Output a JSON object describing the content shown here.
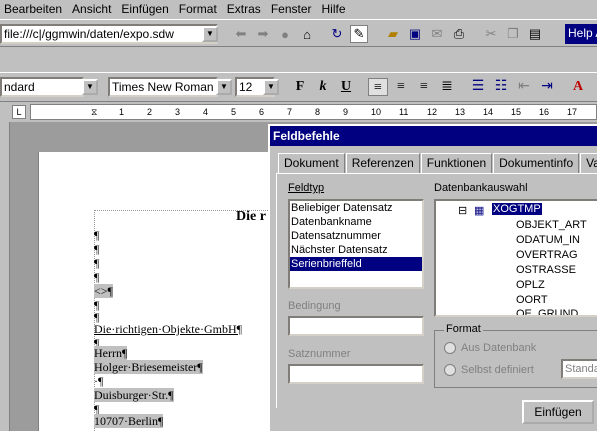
{
  "menu": [
    "Bearbeiten",
    "Ansicht",
    "Einfügen",
    "Format",
    "Extras",
    "Fenster",
    "Hilfe"
  ],
  "url": "file:///c|/ggmwin/daten/expo.sdw",
  "help_label": "Help A",
  "toolbar2": {
    "style": "ndard",
    "font": "Times New Roman",
    "size": "12"
  },
  "ruler": [
    "1",
    "2",
    "3",
    "4",
    "5",
    "6",
    "7",
    "8",
    "9",
    "10",
    "11",
    "12",
    "13",
    "14",
    "15",
    "16",
    "17"
  ],
  "document": {
    "title": "Die r",
    "lines": [
      "¶",
      "¶",
      "¶",
      "¶",
      "<>¶",
      "¶",
      "¶",
      "Die·richtigen·Objekte·GmbH¶",
      "¶",
      "Herrn¶",
      "Holger·Briesemeister¶",
      "·¶",
      "Duisburger·Str.¶",
      "¶",
      "10707·Berlin¶"
    ]
  },
  "dialog": {
    "title": "Feldbefehle",
    "tabs": [
      "Dokument",
      "Referenzen",
      "Funktionen",
      "Dokumentinfo",
      "Variab"
    ],
    "feldtyp_label": "Feldtyp",
    "feldtyp_items": [
      "Beliebiger Datensatz",
      "Datenbankname",
      "Datensatznummer",
      "Nächster Datensatz",
      "Serienbrieffeld"
    ],
    "feldtyp_selected": 4,
    "bedingung_label": "Bedingung",
    "satznummer_label": "Satznummer",
    "db_label": "Datenbankauswahl",
    "db_root": "XOGTMP",
    "db_fields": [
      "OBJEKT_ART",
      "ODATUM_IN",
      "OVERTRAG",
      "OSTRASSE",
      "OPLZ",
      "OORT",
      "OE_GRUND"
    ],
    "format_label": "Format",
    "radio_db": "Aus Datenbank",
    "radio_user": "Selbst definiert",
    "format_value": "Standa",
    "insert_button": "Einfügen"
  }
}
